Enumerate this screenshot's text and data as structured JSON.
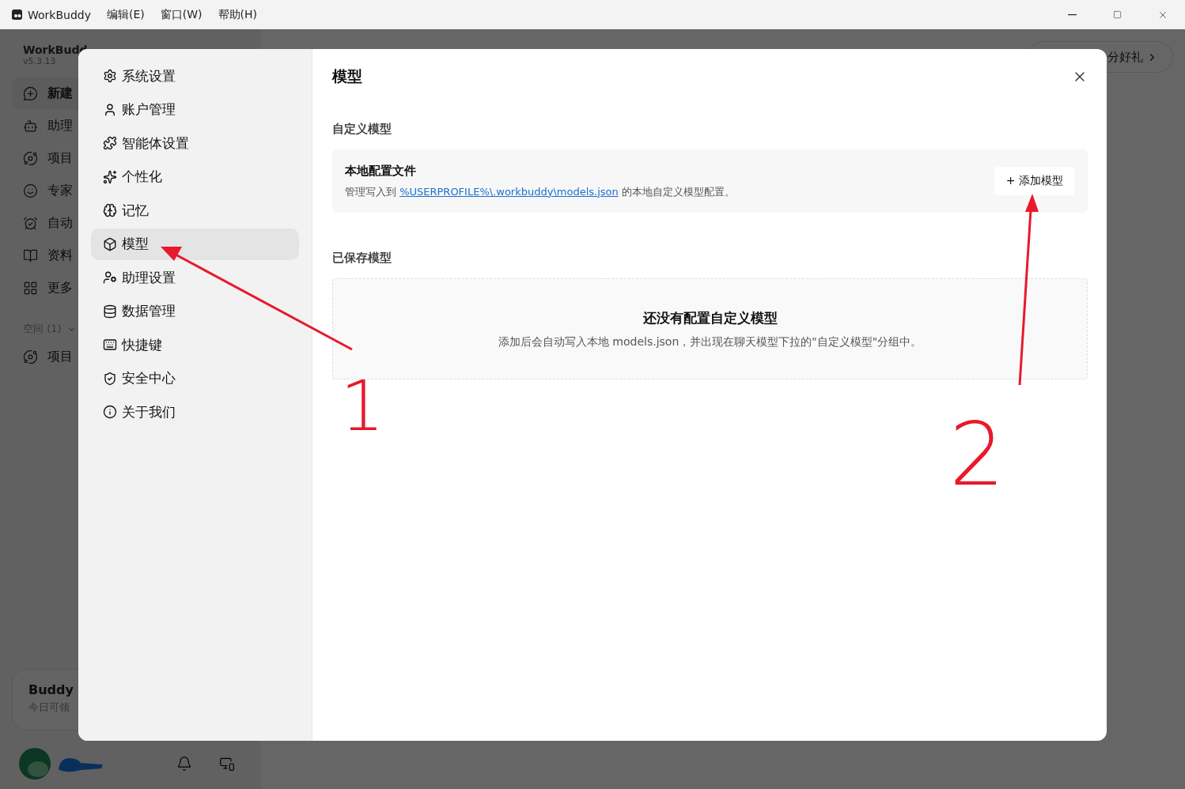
{
  "window": {
    "app_name": "WorkBuddy",
    "menus": [
      "编辑(E)",
      "窗口(W)",
      "帮助(H)"
    ]
  },
  "background": {
    "brand": "WorkBudd",
    "version": "v5.3.13",
    "nav": [
      {
        "kind": "new",
        "label": "新建",
        "selected": true
      },
      {
        "kind": "assistant",
        "label": "助理",
        "selected": false
      },
      {
        "kind": "project",
        "label": "项目",
        "selected": false
      },
      {
        "kind": "expert",
        "label": "专家",
        "selected": false
      },
      {
        "kind": "automation",
        "label": "自动",
        "selected": false
      },
      {
        "kind": "library",
        "label": "资料",
        "selected": false
      },
      {
        "kind": "more",
        "label": "更多",
        "selected": false
      }
    ],
    "space": {
      "label": "空间 (1)",
      "items": [
        "项目"
      ]
    },
    "promo": {
      "title": "Buddy",
      "subtitle": "今日可领"
    },
    "reward_pill": "分好礼"
  },
  "settings": {
    "nav": [
      {
        "kind": "system",
        "label": "系统设置",
        "selected": false
      },
      {
        "kind": "account",
        "label": "账户管理",
        "selected": false
      },
      {
        "kind": "agent",
        "label": "智能体设置",
        "selected": false
      },
      {
        "kind": "personal",
        "label": "个性化",
        "selected": false
      },
      {
        "kind": "memory",
        "label": "记忆",
        "selected": false
      },
      {
        "kind": "model",
        "label": "模型",
        "selected": true
      },
      {
        "kind": "assistant",
        "label": "助理设置",
        "selected": false
      },
      {
        "kind": "data",
        "label": "数据管理",
        "selected": false
      },
      {
        "kind": "shortcut",
        "label": "快捷键",
        "selected": false
      },
      {
        "kind": "security",
        "label": "安全中心",
        "selected": false
      },
      {
        "kind": "about",
        "label": "关于我们",
        "selected": false
      }
    ],
    "title": "模型",
    "custom_section": {
      "heading": "自定义模型",
      "card_title": "本地配置文件",
      "desc_before": "管理写入到",
      "link": "%USERPROFILE%\\.workbuddy\\models.json",
      "desc_after": "的本地自定义模型配置。",
      "button": "+ 添加模型"
    },
    "saved_section": {
      "heading": "已保存模型",
      "empty_title": "还没有配置自定义模型",
      "empty_desc": "添加后会自动写入本地 models.json，并出现在聊天模型下拉的\"自定义模型\"分组中。"
    }
  },
  "annotations": [
    {
      "label": "1"
    },
    {
      "label": "2"
    }
  ]
}
